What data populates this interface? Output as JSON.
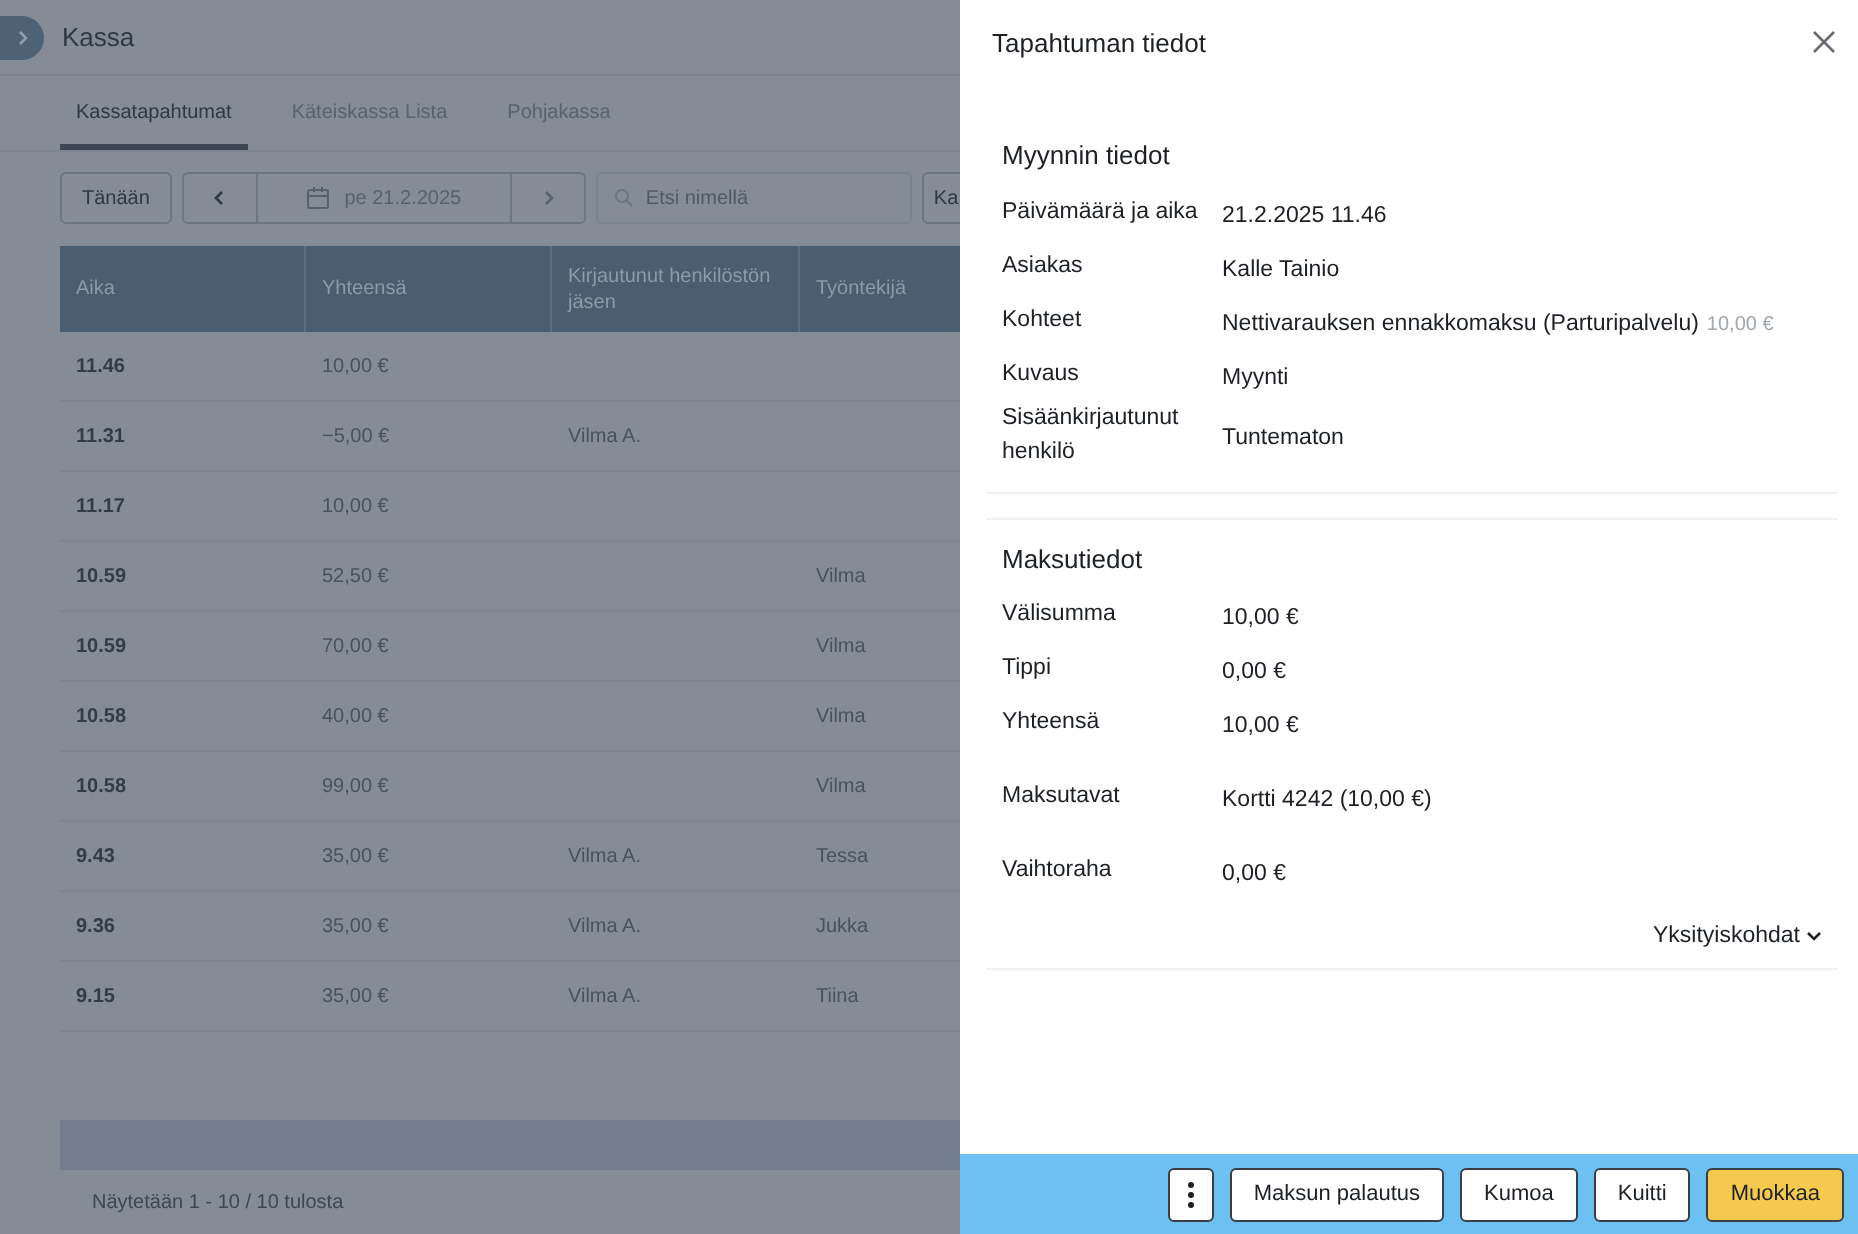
{
  "page": {
    "title": "Kassa"
  },
  "tabs": [
    {
      "label": "Kassatapahtumat",
      "selected": true
    },
    {
      "label": "Käteiskassa Lista",
      "selected": false
    },
    {
      "label": "Pohjakassa",
      "selected": false
    }
  ],
  "toolbar": {
    "today_button": "Tänään",
    "date": "pe 21.2.2025",
    "search": {
      "placeholder": "Etsi nimellä"
    },
    "cut_button": "Ka"
  },
  "table": {
    "columns": [
      "Aika",
      "Yhteensä",
      "Kirjautunut henkilöstön jäsen",
      "Työntekijä"
    ],
    "rows": [
      {
        "time": "11.46",
        "total": "10,00 €"
      },
      {
        "time": "11.31",
        "total": "−5,00 €",
        "staff": "Vilma A."
      },
      {
        "time": "11.17",
        "total": "10,00 €"
      },
      {
        "time": "10.59",
        "total": "52,50 €",
        "employee": "Vilma"
      },
      {
        "time": "10.59",
        "total": "70,00 €",
        "employee": "Vilma"
      },
      {
        "time": "10.58",
        "total": "40,00 €",
        "employee": "Vilma"
      },
      {
        "time": "10.58",
        "total": "99,00 €",
        "employee": "Vilma"
      },
      {
        "time": "9.43",
        "total": "35,00 €",
        "staff": "Vilma A.",
        "employee": "Tessa"
      },
      {
        "time": "9.36",
        "total": "35,00 €",
        "staff": "Vilma A.",
        "employee": "Jukka"
      },
      {
        "time": "9.15",
        "total": "35,00 €",
        "staff": "Vilma A.",
        "employee": "Tiina"
      }
    ],
    "footer": "Näytetään 1 - 10 / 10 tulosta"
  },
  "drawer": {
    "title": "Tapahtuman tiedot",
    "sections": [
      {
        "title": "Myynnin tiedot",
        "rows": [
          {
            "kind": "row",
            "label": "Päivämäärä ja aika",
            "value": "21.2.2025 11.46"
          },
          {
            "kind": "row",
            "label": "Asiakas",
            "value": "Kalle Tainio"
          },
          {
            "kind": "row",
            "label": "Kohteet",
            "value": "Nettivarauksen ennakkomaksu (Parturipalvelu)",
            "note": "10,00 €"
          },
          {
            "kind": "row",
            "label": "Kuvaus",
            "value": "Myynti"
          },
          {
            "kind": "row",
            "label": "Sisäänkirjautunut henkilö",
            "value": "Tuntematon"
          }
        ]
      },
      {
        "title": "Maksutiedot",
        "rows": [
          {
            "kind": "row",
            "label": "Välisumma",
            "value": "10,00 €"
          },
          {
            "kind": "row",
            "label": "Tippi",
            "value": "0,00 €"
          },
          {
            "kind": "row",
            "label": "Yhteensä",
            "value": "10,00 €"
          },
          {
            "kind": "spaced",
            "label": "Maksutavat",
            "value": "Kortti 4242 (10,00 €)"
          },
          {
            "kind": "spaced",
            "label": "Vaihtoraha",
            "value": "0,00 €"
          }
        ],
        "details_link": "Yksityiskohdat"
      }
    ],
    "actions": [
      {
        "label": "Maksun palautus",
        "primary": false
      },
      {
        "label": "Kumoa",
        "primary": false
      },
      {
        "label": "Kuitti",
        "primary": false
      },
      {
        "label": "Muokkaa",
        "primary": true
      }
    ]
  }
}
